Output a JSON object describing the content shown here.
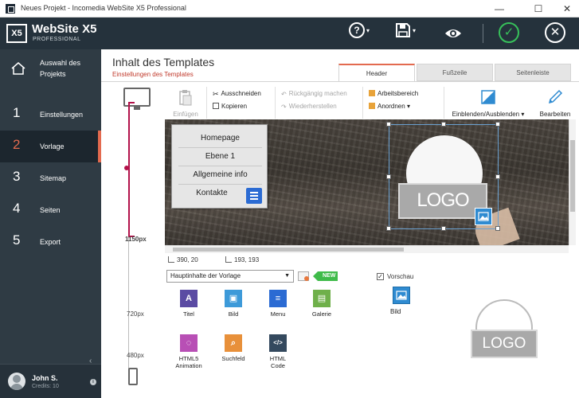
{
  "window": {
    "title": "Neues Projekt - Incomedia WebSite X5 Professional",
    "minimize": "—",
    "maximize": "☐",
    "close": "✕"
  },
  "header": {
    "logo_mark": "X5",
    "brand": "WebSite X5",
    "edition": "PROFESSIONAL",
    "help": "?",
    "save": "▾",
    "ok": "✓",
    "close": "✕"
  },
  "sidebar": {
    "home_label": "Auswahl des Projekts",
    "items": [
      {
        "num": "1",
        "label": "Einstellungen",
        "color": "#e74c3c"
      },
      {
        "num": "2",
        "label": "Vorlage",
        "color": "#e36a4f"
      },
      {
        "num": "3",
        "label": "Sitemap",
        "color": "#27ae60"
      },
      {
        "num": "4",
        "label": "Seiten",
        "color": "#2980b9"
      },
      {
        "num": "5",
        "label": "Export",
        "color": "#2e86de"
      }
    ],
    "collapse": "‹",
    "user_name": "John S.",
    "user_sub": "Credits: 10"
  },
  "main": {
    "title": "Inhalt des Templates",
    "subtitle": "Einstellungen des Templates",
    "tabs": [
      {
        "label": "Header",
        "active": true
      },
      {
        "label": "Fußzeile",
        "active": false
      },
      {
        "label": "Seitenleiste",
        "active": false
      }
    ]
  },
  "rail": {
    "res_1150": "1150px",
    "res_720": "720px",
    "res_480": "480px"
  },
  "toolbar": {
    "paste": "Einfügen",
    "cut": "Ausschneiden",
    "copy": "Kopieren",
    "undo": "Rückgängig machen",
    "redo": "Wiederherstellen",
    "workspace": "Arbeitsbereich",
    "arrange": "Anordnen",
    "show_hide": "Einblenden/Ausblenden",
    "edit": "Bearbeiten"
  },
  "canvas": {
    "menu": [
      "Homepage",
      "Ebene 1",
      "Allgemeine info",
      "Kontakte"
    ],
    "logo_text": "LOGO"
  },
  "status": {
    "position": "390, 20",
    "size": "193, 193"
  },
  "objects": {
    "dropdown_value": "Hauptinhalte der Vorlage",
    "new_badge": "NEW",
    "items": [
      {
        "label": "Titel",
        "icon": "title-icon",
        "color": "#5b4ba3",
        "glyph": "A"
      },
      {
        "label": "Bild",
        "icon": "image-icon",
        "color": "#3d9ad9",
        "glyph": "▣"
      },
      {
        "label": "Menu",
        "icon": "menu-icon",
        "color": "#2b6bd3",
        "glyph": "≡"
      },
      {
        "label": "Galerie",
        "icon": "gallery-icon",
        "color": "#6fb04a",
        "glyph": "▤"
      },
      {
        "label": "HTML5 Animation",
        "icon": "animation-icon",
        "color": "#b84fb5",
        "glyph": "◌"
      },
      {
        "label": "Suchfeld",
        "icon": "search-icon",
        "color": "#e8903a",
        "glyph": "⌕"
      },
      {
        "label": "HTML Code",
        "icon": "code-icon",
        "color": "#34495e",
        "glyph": "</>"
      }
    ],
    "preview_label": "Vorschau",
    "preview_checked": "✓",
    "preview_item": "Bild",
    "preview_logo": "LOGO"
  }
}
